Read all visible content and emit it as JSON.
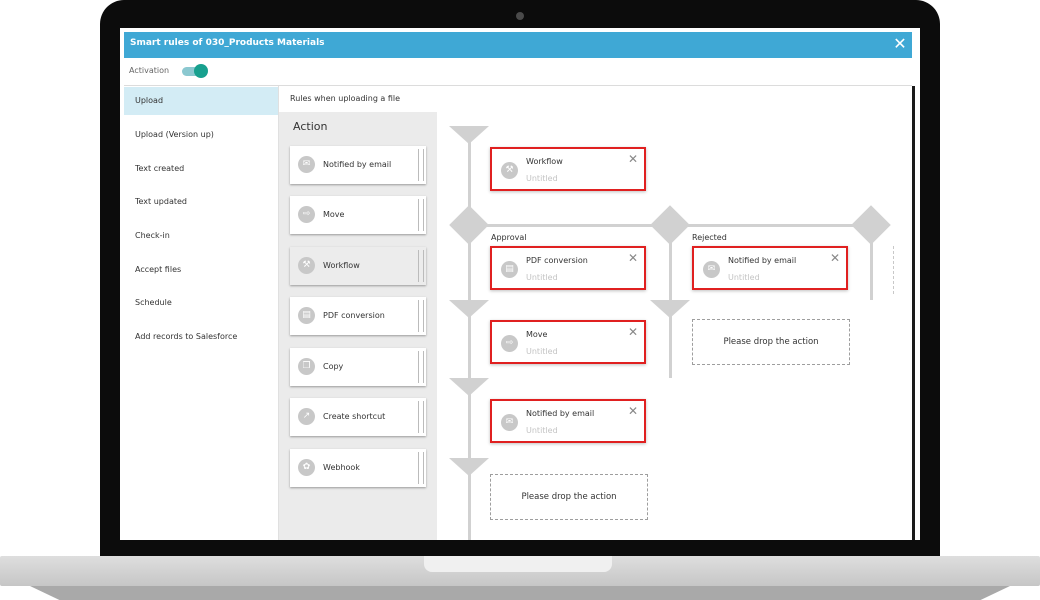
{
  "window": {
    "title": "Smart rules of 030_Products Materials"
  },
  "activation": {
    "label": "Activation",
    "enabled": true,
    "accent_color": "#17a08e"
  },
  "nav": {
    "items": [
      {
        "label": "Upload",
        "active": true
      },
      {
        "label": "Upload (Version up)"
      },
      {
        "label": "Text created"
      },
      {
        "label": "Text updated"
      },
      {
        "label": "Check-in"
      },
      {
        "label": "Accept files"
      },
      {
        "label": "Schedule"
      },
      {
        "label": "Add records to Salesforce"
      }
    ]
  },
  "rules": {
    "title": "Rules when uploading a file"
  },
  "palette": {
    "heading": "Action",
    "actions": [
      {
        "label": "Notified by email",
        "icon": "envelope-icon"
      },
      {
        "label": "Move",
        "icon": "move-icon"
      },
      {
        "label": "Workflow",
        "icon": "gavel-icon",
        "selected": true
      },
      {
        "label": "PDF conversion",
        "icon": "pdf-icon"
      },
      {
        "label": "Copy",
        "icon": "copy-icon"
      },
      {
        "label": "Create shortcut",
        "icon": "shortcut-icon"
      },
      {
        "label": "Webhook",
        "icon": "webhook-icon"
      }
    ]
  },
  "flow": {
    "branches": {
      "approval": "Approval",
      "rejected": "Rejected"
    },
    "nodes": [
      {
        "title": "Workflow",
        "subtitle": "Untitled",
        "icon": "gavel-icon"
      },
      {
        "title": "PDF conversion",
        "subtitle": "Untitled",
        "icon": "pdf-icon"
      },
      {
        "title": "Notified by email",
        "subtitle": "Untitled",
        "icon": "envelope-icon"
      },
      {
        "title": "Move",
        "subtitle": "Untitled",
        "icon": "move-icon"
      },
      {
        "title": "Notified by email",
        "subtitle": "Untitled",
        "icon": "envelope-icon"
      }
    ],
    "drop_text": "Please drop the action",
    "highlight_color": "#e02020"
  }
}
